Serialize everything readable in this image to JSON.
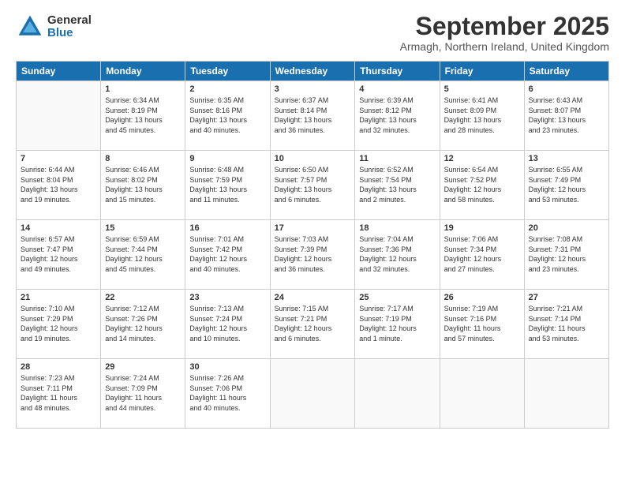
{
  "logo": {
    "general": "General",
    "blue": "Blue"
  },
  "title": "September 2025",
  "subtitle": "Armagh, Northern Ireland, United Kingdom",
  "headers": [
    "Sunday",
    "Monday",
    "Tuesday",
    "Wednesday",
    "Thursday",
    "Friday",
    "Saturday"
  ],
  "weeks": [
    [
      {
        "day": "",
        "info": ""
      },
      {
        "day": "1",
        "info": "Sunrise: 6:34 AM\nSunset: 8:19 PM\nDaylight: 13 hours\nand 45 minutes."
      },
      {
        "day": "2",
        "info": "Sunrise: 6:35 AM\nSunset: 8:16 PM\nDaylight: 13 hours\nand 40 minutes."
      },
      {
        "day": "3",
        "info": "Sunrise: 6:37 AM\nSunset: 8:14 PM\nDaylight: 13 hours\nand 36 minutes."
      },
      {
        "day": "4",
        "info": "Sunrise: 6:39 AM\nSunset: 8:12 PM\nDaylight: 13 hours\nand 32 minutes."
      },
      {
        "day": "5",
        "info": "Sunrise: 6:41 AM\nSunset: 8:09 PM\nDaylight: 13 hours\nand 28 minutes."
      },
      {
        "day": "6",
        "info": "Sunrise: 6:43 AM\nSunset: 8:07 PM\nDaylight: 13 hours\nand 23 minutes."
      }
    ],
    [
      {
        "day": "7",
        "info": "Sunrise: 6:44 AM\nSunset: 8:04 PM\nDaylight: 13 hours\nand 19 minutes."
      },
      {
        "day": "8",
        "info": "Sunrise: 6:46 AM\nSunset: 8:02 PM\nDaylight: 13 hours\nand 15 minutes."
      },
      {
        "day": "9",
        "info": "Sunrise: 6:48 AM\nSunset: 7:59 PM\nDaylight: 13 hours\nand 11 minutes."
      },
      {
        "day": "10",
        "info": "Sunrise: 6:50 AM\nSunset: 7:57 PM\nDaylight: 13 hours\nand 6 minutes."
      },
      {
        "day": "11",
        "info": "Sunrise: 6:52 AM\nSunset: 7:54 PM\nDaylight: 13 hours\nand 2 minutes."
      },
      {
        "day": "12",
        "info": "Sunrise: 6:54 AM\nSunset: 7:52 PM\nDaylight: 12 hours\nand 58 minutes."
      },
      {
        "day": "13",
        "info": "Sunrise: 6:55 AM\nSunset: 7:49 PM\nDaylight: 12 hours\nand 53 minutes."
      }
    ],
    [
      {
        "day": "14",
        "info": "Sunrise: 6:57 AM\nSunset: 7:47 PM\nDaylight: 12 hours\nand 49 minutes."
      },
      {
        "day": "15",
        "info": "Sunrise: 6:59 AM\nSunset: 7:44 PM\nDaylight: 12 hours\nand 45 minutes."
      },
      {
        "day": "16",
        "info": "Sunrise: 7:01 AM\nSunset: 7:42 PM\nDaylight: 12 hours\nand 40 minutes."
      },
      {
        "day": "17",
        "info": "Sunrise: 7:03 AM\nSunset: 7:39 PM\nDaylight: 12 hours\nand 36 minutes."
      },
      {
        "day": "18",
        "info": "Sunrise: 7:04 AM\nSunset: 7:36 PM\nDaylight: 12 hours\nand 32 minutes."
      },
      {
        "day": "19",
        "info": "Sunrise: 7:06 AM\nSunset: 7:34 PM\nDaylight: 12 hours\nand 27 minutes."
      },
      {
        "day": "20",
        "info": "Sunrise: 7:08 AM\nSunset: 7:31 PM\nDaylight: 12 hours\nand 23 minutes."
      }
    ],
    [
      {
        "day": "21",
        "info": "Sunrise: 7:10 AM\nSunset: 7:29 PM\nDaylight: 12 hours\nand 19 minutes."
      },
      {
        "day": "22",
        "info": "Sunrise: 7:12 AM\nSunset: 7:26 PM\nDaylight: 12 hours\nand 14 minutes."
      },
      {
        "day": "23",
        "info": "Sunrise: 7:13 AM\nSunset: 7:24 PM\nDaylight: 12 hours\nand 10 minutes."
      },
      {
        "day": "24",
        "info": "Sunrise: 7:15 AM\nSunset: 7:21 PM\nDaylight: 12 hours\nand 6 minutes."
      },
      {
        "day": "25",
        "info": "Sunrise: 7:17 AM\nSunset: 7:19 PM\nDaylight: 12 hours\nand 1 minute."
      },
      {
        "day": "26",
        "info": "Sunrise: 7:19 AM\nSunset: 7:16 PM\nDaylight: 11 hours\nand 57 minutes."
      },
      {
        "day": "27",
        "info": "Sunrise: 7:21 AM\nSunset: 7:14 PM\nDaylight: 11 hours\nand 53 minutes."
      }
    ],
    [
      {
        "day": "28",
        "info": "Sunrise: 7:23 AM\nSunset: 7:11 PM\nDaylight: 11 hours\nand 48 minutes."
      },
      {
        "day": "29",
        "info": "Sunrise: 7:24 AM\nSunset: 7:09 PM\nDaylight: 11 hours\nand 44 minutes."
      },
      {
        "day": "30",
        "info": "Sunrise: 7:26 AM\nSunset: 7:06 PM\nDaylight: 11 hours\nand 40 minutes."
      },
      {
        "day": "",
        "info": ""
      },
      {
        "day": "",
        "info": ""
      },
      {
        "day": "",
        "info": ""
      },
      {
        "day": "",
        "info": ""
      }
    ]
  ]
}
